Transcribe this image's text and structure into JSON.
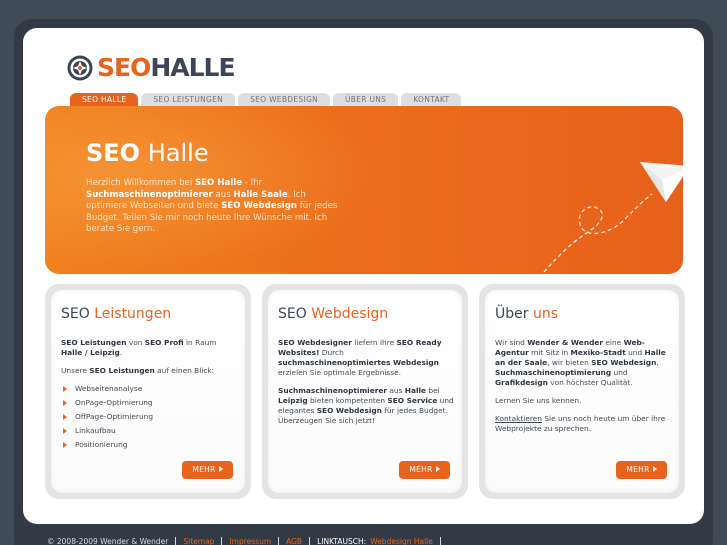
{
  "logo": {
    "seo": "SEO",
    "halle": "HALLE"
  },
  "nav": {
    "tabs": [
      {
        "label": "SEO HALLE",
        "active": true
      },
      {
        "label": "SEO LEISTUNGEN",
        "active": false
      },
      {
        "label": "SEO WEBDESIGN",
        "active": false
      },
      {
        "label": "ÜBER UNS",
        "active": false
      },
      {
        "label": "KONTAKT",
        "active": false
      }
    ]
  },
  "hero": {
    "title_bold": "SEO",
    "title_light": "Halle",
    "text": [
      {
        "t": "Herzlich Willkommen bei ",
        "b": false
      },
      {
        "t": "SEO Halle",
        "b": true
      },
      {
        "t": " - Ihr ",
        "b": false
      },
      {
        "t": "Suchmaschinenoptimierer",
        "b": true
      },
      {
        "t": " aus ",
        "b": false
      },
      {
        "t": "Halle Saale",
        "b": true
      },
      {
        "t": ". Ich optimiere Webseiten und biete ",
        "b": false
      },
      {
        "t": "SEO Webdesign",
        "b": true
      },
      {
        "t": " für jedes Budget. Teilen Sie mir noch heute Ihre Wünsche mit. Ich berate Sie gern.",
        "b": false
      }
    ]
  },
  "boxes": {
    "leistungen": {
      "title_dark": "SEO",
      "title_accent": "Leistungen",
      "p1": [
        {
          "t": "SEO Leistungen",
          "b": true
        },
        {
          "t": " von ",
          "b": false
        },
        {
          "t": "SEO Profi",
          "b": true
        },
        {
          "t": " in Raum ",
          "b": false
        },
        {
          "t": "Halle / Leipzig",
          "b": true
        },
        {
          "t": ".",
          "b": false
        }
      ],
      "p2": [
        {
          "t": "Unsere ",
          "b": false
        },
        {
          "t": "SEO Leistungen",
          "b": true
        },
        {
          "t": " auf einen Blick:",
          "b": false
        }
      ],
      "list": [
        "Webseitenanalyse",
        "OnPage-Optimierung",
        "OffPage-Optimierung",
        "Linkaufbau",
        "Positionierung"
      ],
      "more": "MEHR"
    },
    "webdesign": {
      "title_dark": "SEO",
      "title_accent": "Webdesign",
      "p1": [
        {
          "t": "SEO Webdesigner",
          "b": true
        },
        {
          "t": " liefern ihre ",
          "b": false
        },
        {
          "t": "SEO Ready Websites!",
          "b": true
        },
        {
          "t": " Durch ",
          "b": false
        },
        {
          "t": "suchmaschinenoptimiertes Webdesign",
          "b": true
        },
        {
          "t": " erzielen Sie optimale Ergebnisse.",
          "b": false
        }
      ],
      "p2": [
        {
          "t": "Suchmaschinenoptimierer",
          "b": true
        },
        {
          "t": " aus ",
          "b": false
        },
        {
          "t": "Halle",
          "b": true
        },
        {
          "t": " bei ",
          "b": false
        },
        {
          "t": "Leipzig",
          "b": true
        },
        {
          "t": " bieten kompetenten ",
          "b": false
        },
        {
          "t": "SEO Service",
          "b": true
        },
        {
          "t": " und elegantes ",
          "b": false
        },
        {
          "t": "SEO Webdesign",
          "b": true
        },
        {
          "t": " für jedes Budget. Überzeugen Sie sich jetzt!",
          "b": false
        }
      ],
      "more": "MEHR"
    },
    "ueber": {
      "title_dark": "Über",
      "title_accent": "uns",
      "p1": [
        {
          "t": "Wir sind ",
          "b": false
        },
        {
          "t": "Wender & Wender",
          "b": true
        },
        {
          "t": " eine ",
          "b": false
        },
        {
          "t": "Web-Agentur",
          "b": true
        },
        {
          "t": " mit Sitz in ",
          "b": false
        },
        {
          "t": "Mexiko-Stadt",
          "b": true
        },
        {
          "t": " und ",
          "b": false
        },
        {
          "t": "Halle an der Saale",
          "b": true
        },
        {
          "t": ", wir bieten ",
          "b": false
        },
        {
          "t": "SEO Webdesign",
          "b": true
        },
        {
          "t": ", ",
          "b": false
        },
        {
          "t": "Suchmaschinenoptimierung",
          "b": true
        },
        {
          "t": " und ",
          "b": false
        },
        {
          "t": "Grafikdesign",
          "b": true
        },
        {
          "t": " von höchster Qualität.",
          "b": false
        }
      ],
      "p2": "Lernen Sie uns kennen.",
      "p3_link": "Kontaktieren",
      "p3_rest": " Sie uns noch heute um über ihre Webprojekte zu sprechen.",
      "more": "MEHR"
    }
  },
  "footer": {
    "copyright": "© 2008-2009 Wender & Wender",
    "links": [
      "Sitemap",
      "Impressum",
      "AGB"
    ],
    "linktausch_label": "LINKTAUSCH:",
    "linktausch_link": "Webdesign Halle"
  },
  "colors": {
    "accent": "#e8631d",
    "dark": "#3c4656",
    "background": "#404b58"
  }
}
